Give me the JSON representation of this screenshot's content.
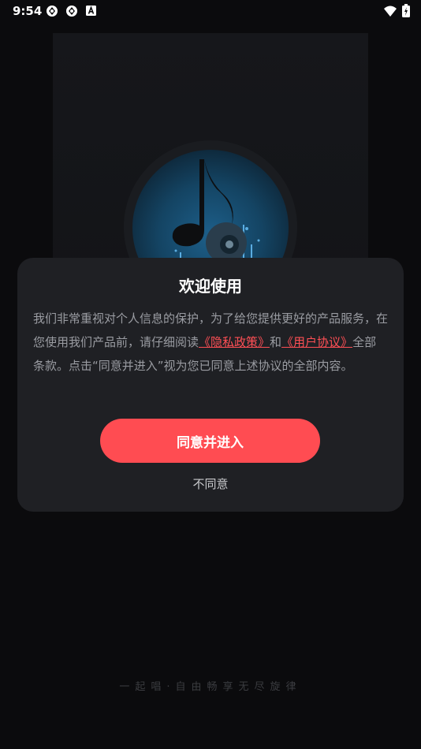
{
  "status_bar": {
    "time": "9:54",
    "left_icons": [
      "notification-icon",
      "notification-icon",
      "text-a-icon"
    ],
    "right_icons": [
      "wifi-icon",
      "battery-icon"
    ]
  },
  "dialog": {
    "title": "欢迎使用",
    "body_part1": "我们非常重视对个人信息的保护，为了给您提供更好的产品服务，在您使用我们产品前，请仔细阅读",
    "privacy_link": "《隐私政策》",
    "and_text": "和",
    "agreement_link": "《用户协议》",
    "body_part2": "全部条款。点击“同意并进入”视为您已同意上述协议的全部内容。",
    "agree_button": "同意并进入",
    "disagree_button": "不同意"
  },
  "slogan": "一起唱·自由畅享无尽旋律",
  "colors": {
    "accent": "#ff4c52",
    "dialog_bg": "#1f2024",
    "page_bg": "#0b0b0d"
  }
}
